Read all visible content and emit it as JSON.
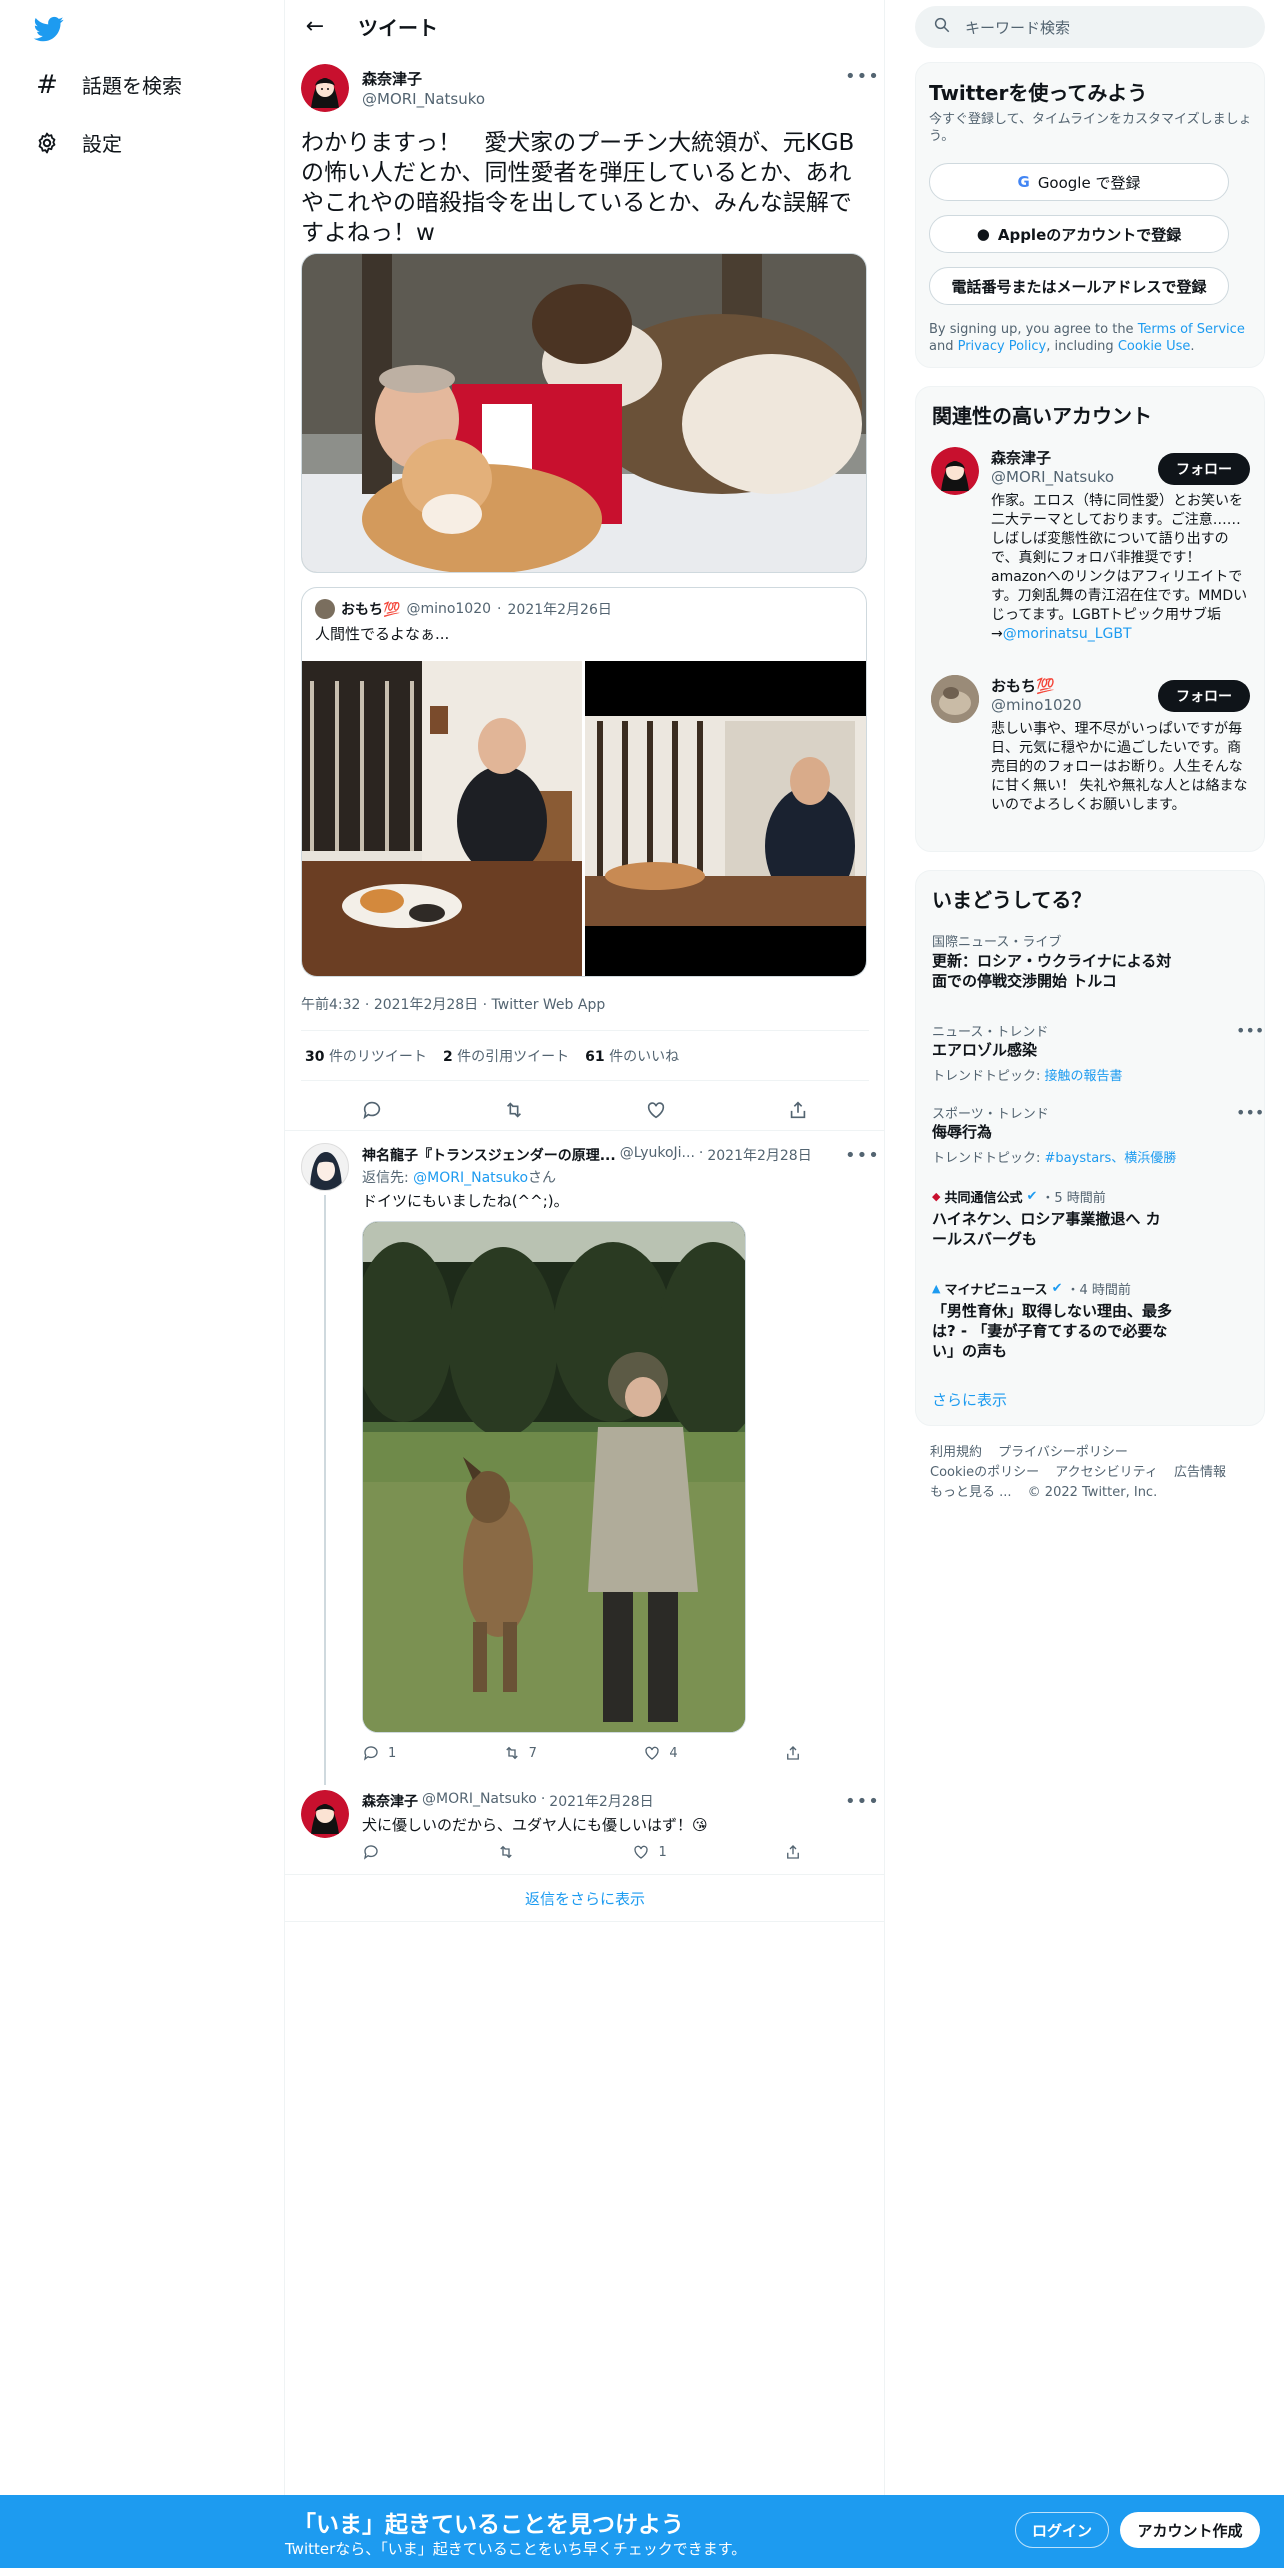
{
  "nav": {
    "explore_label": "話題を検索",
    "settings_label": "設定"
  },
  "header": {
    "title": "ツイート"
  },
  "tweet": {
    "author_name": "森奈津子",
    "author_handle": "@MORI_Natsuko",
    "text": "わかりますっ！　愛犬家のプーチン大統領が、元KGBの怖い人だとか、同性愛者を弾圧しているとか、あれやこれやの暗殺指令を出しているとか、みんな誤解ですよねっ！w",
    "time": "午前4:32",
    "date": "2021年2月28日",
    "client": "Twitter Web App",
    "retweets": "30",
    "retweets_label": "件のリツイート",
    "quotes": "2",
    "quotes_label": "件の引用ツイート",
    "likes": "61",
    "likes_label": "件のいいね",
    "quoted": {
      "name": "おもち💯",
      "handle": "@mino1020",
      "date": "2021年2月26日",
      "text": "人間性でるよなぁ..."
    }
  },
  "replies": [
    {
      "name": "神名龍子『トランスジェンダーの原理...",
      "handle": "@LyukoJi...",
      "date": "2021年2月28日",
      "reply_to_label": "返信先: ",
      "reply_to": "@MORI_Natsuko",
      "reply_to_suffix": "さん",
      "text": "ドイツにもいましたね(^^;)。",
      "comments": "1",
      "retweets": "7",
      "likes": "4"
    },
    {
      "name": "森奈津子",
      "handle": "@MORI_Natsuko",
      "date": "2021年2月28日",
      "text": "犬に優しいのだから、ユダヤ人にも優しいはず！😘",
      "likes": "1"
    }
  ],
  "more_replies_label": "返信をさらに表示",
  "search": {
    "placeholder": "キーワード検索"
  },
  "signup_card": {
    "title": "Twitterを使ってみよう",
    "subtitle": "今すぐ登録して、タイムラインをカスタマイズしましょう。",
    "google_label": "Google で登録",
    "apple_label": "Appleのアカウントで登録",
    "phone_label": "電話番号またはメールアドレスで登録",
    "legal_prefix": "By signing up, you agree to the ",
    "terms": "Terms of Service",
    "legal_and": " and ",
    "privacy": "Privacy Policy",
    "legal_including": ", including ",
    "cookie": "Cookie Use",
    "legal_end": "."
  },
  "relevant": {
    "title": "関連性の高いアカウント",
    "follow_label": "フォロー",
    "accounts": [
      {
        "name": "森奈津子",
        "handle": "@MORI_Natsuko",
        "bio": "作家。エロス（特に同性愛）とお笑いを二大テーマとしております。ご注意……しばしば変態性欲について語り出すので、真剣にフォロバ非推奨です！ amazonへのリンクはアフィリエイトです。刀剣乱舞の青江沼在住です。MMDいじってます。LGBTトピック用サブ垢→",
        "bio_link": "@morinatsu_LGBT"
      },
      {
        "name": "おもち💯",
        "handle": "@mino1020",
        "bio": "悲しい事や、理不尽がいっぱいですが毎日、元気に穏やかに過ごしたいです。商売目的のフォローはお断り。人生そんなに甘く無い！ 失礼や無礼な人とは絡まないのでよろしくお願いします。"
      }
    ]
  },
  "trends": {
    "title": "いまどうしてる？",
    "items": [
      {
        "category": "国際ニュース・ライブ",
        "title": "更新：ロシア・ウクライナによる対面での停戦交渉開始 トルコ"
      },
      {
        "category": "ニュース・トレンド",
        "title": "エアロゾル感染",
        "sub_label": "トレンドトピック: ",
        "sub_link": "接触の報告書"
      },
      {
        "category": "スポーツ・トレンド",
        "title": "侮辱行為",
        "sub_label": "トレンドトピック: ",
        "sub_link": "#baystars、横浜優勝"
      },
      {
        "source": "共同通信公式",
        "age": "・5 時間前",
        "title": "ハイネケン、ロシア事業撤退へ カールスバーグも"
      },
      {
        "source": "マイナビニュース",
        "age": "・4 時間前",
        "title": "「男性育休」取得しない理由、最多は? - 「妻が子育てするので必要ない」の声も"
      }
    ],
    "show_more": "さらに表示"
  },
  "footer": {
    "links": [
      "利用規約",
      "プライバシーポリシー",
      "Cookieのポリシー",
      "アクセシビリティ",
      "広告情報",
      "もっと見る ..."
    ],
    "copyright": "© 2022 Twitter, Inc."
  },
  "banner": {
    "title": "「いま」起きていることを見つけよう",
    "subtitle": "Twitterなら、「いま」起きていることをいち早くチェックできます。",
    "login": "ログイン",
    "signup": "アカウント作成"
  },
  "colors": {
    "accent": "#1d9bf0",
    "text": "#0f1419",
    "muted": "#536471"
  }
}
